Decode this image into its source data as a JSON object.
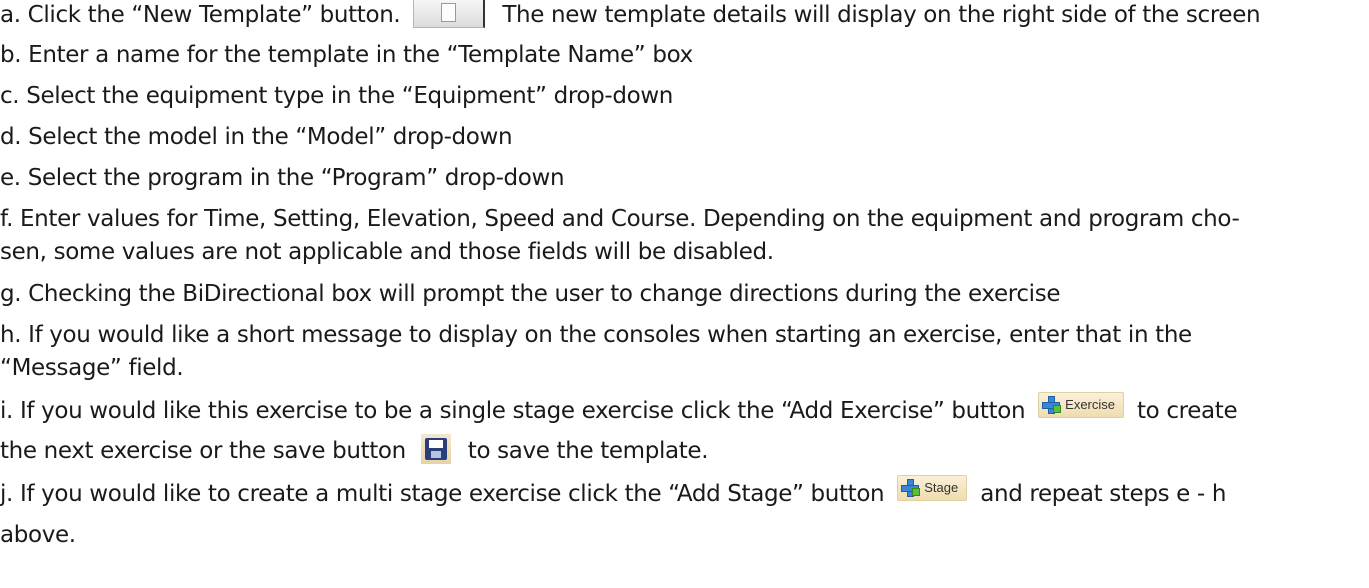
{
  "steps": {
    "a": {
      "before": "a. Click the “New Template” button.",
      "after": "The new template details will display on the right side of the screen"
    },
    "b": "b. Enter a name for the template in the “Template Name” box",
    "c": "c. Select the equipment type in the “Equipment” drop-down",
    "d": "d. Select the model in the “Model” drop-down",
    "e": "e. Select the program in the “Program” drop-down",
    "f": {
      "line1": "f. Enter values for Time, Setting, Elevation, Speed and Course. Depending on the equipment and program cho-",
      "line2": "sen, some values are not applicable and those fields will be disabled."
    },
    "g": "g. Checking the BiDirectional box will prompt the user to change directions during the exercise",
    "h": {
      "line1": "h. If you would like a short message to display on the consoles when starting an exercise, enter that in the",
      "line2": "“Message” field."
    },
    "i": {
      "before": "i. If you would like this exercise to be a single stage exercise click the “Add Exercise” button",
      "after": "to create",
      "line2_before": "the next exercise or the save button",
      "line2_after": "to save the template."
    },
    "j": {
      "before": "j. If you would like to create a multi stage exercise click the “Add Stage” button",
      "after": "and repeat steps e - h",
      "line2": "above."
    }
  },
  "buttons": {
    "exercise_label": "Exercise",
    "stage_label": "Stage"
  },
  "icons": {
    "new_template": "blank-page-icon",
    "add": "plus-icon",
    "save": "floppy-disk-icon"
  },
  "colors": {
    "text": "#1a1a1a",
    "plus_blue": "#3a86d6",
    "plus_green": "#5cbf3a",
    "floppy": "#2a3f7a"
  }
}
